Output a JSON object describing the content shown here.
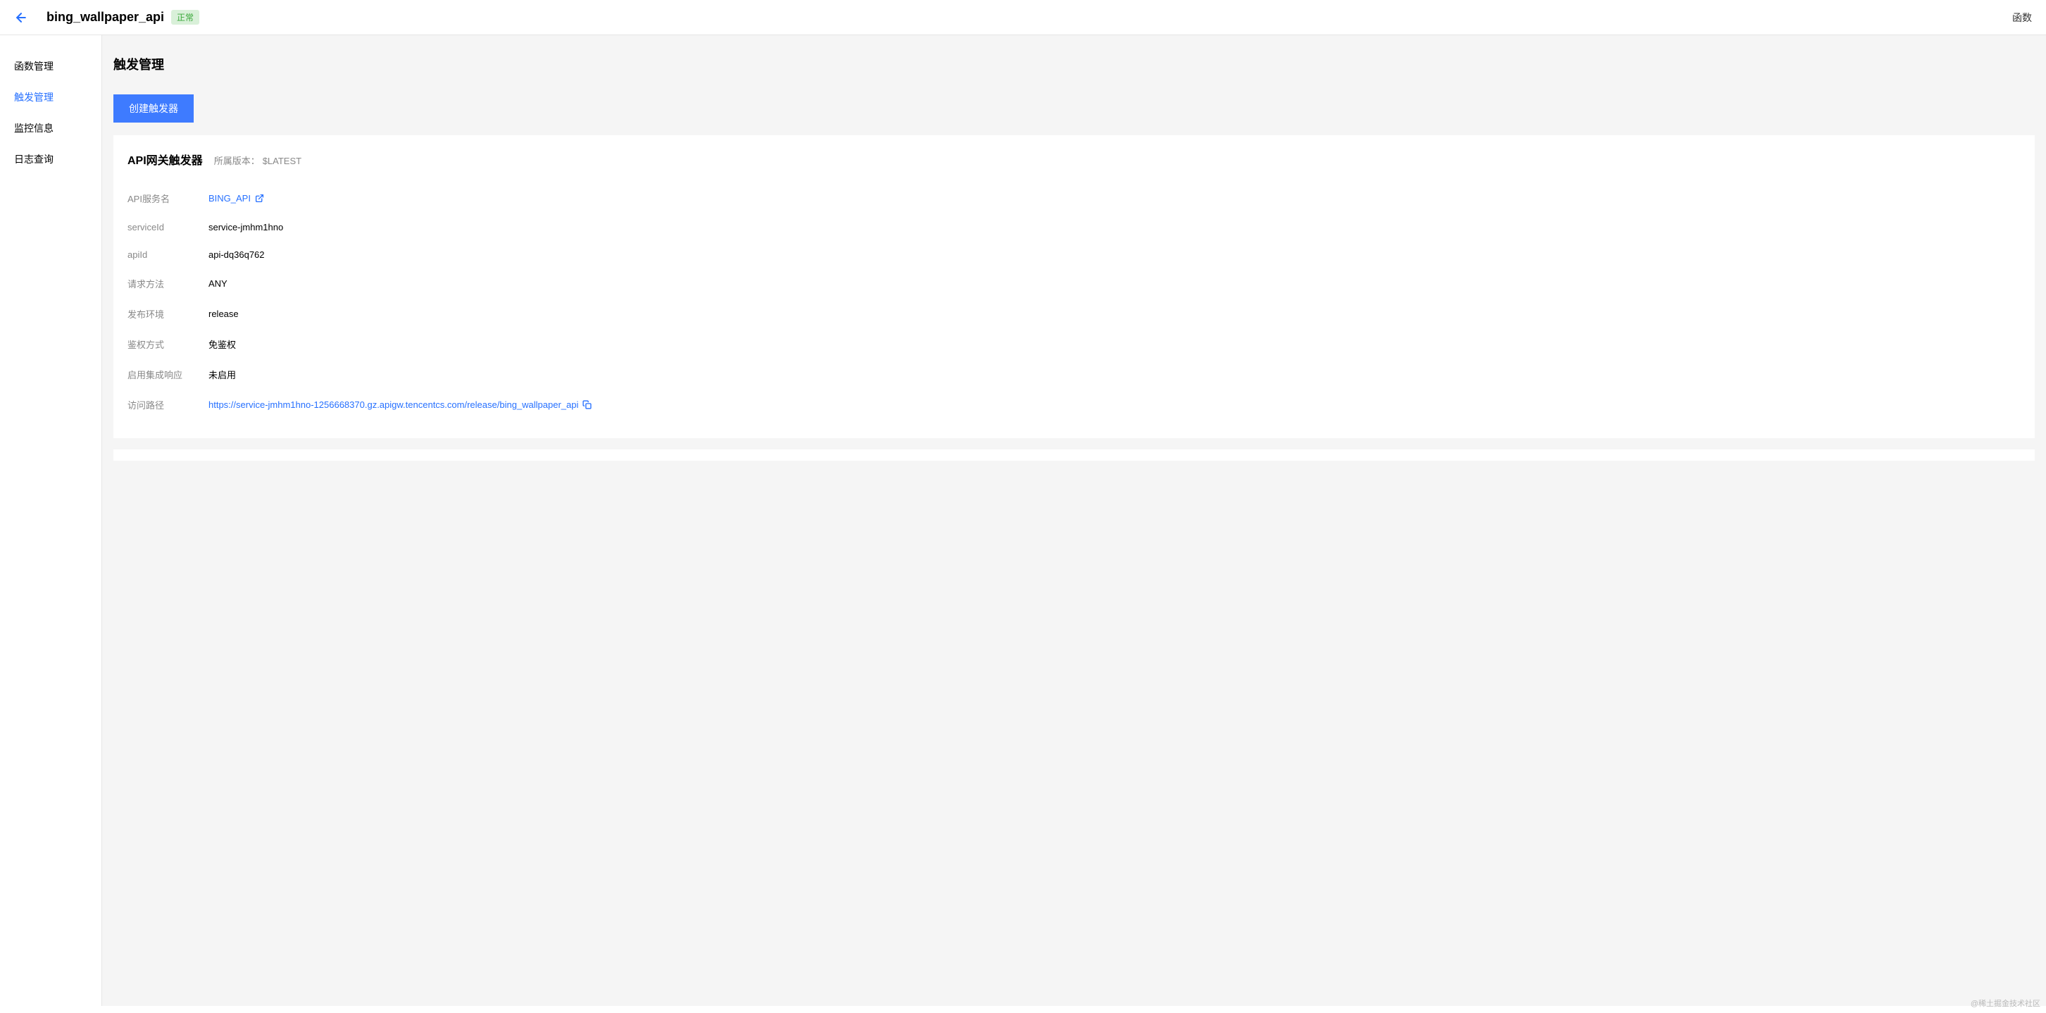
{
  "header": {
    "title": "bing_wallpaper_api",
    "status": "正常",
    "right_text": "函数"
  },
  "sidebar": {
    "items": [
      {
        "label": "函数管理"
      },
      {
        "label": "触发管理"
      },
      {
        "label": "监控信息"
      },
      {
        "label": "日志查询"
      }
    ]
  },
  "page": {
    "heading": "触发管理",
    "create_button": "创建触发器"
  },
  "card": {
    "title": "API网关触发器",
    "version_label": "所属版本：",
    "version_value": "$LATEST",
    "fields": {
      "api_service_name": {
        "label": "API服务名",
        "value": "BING_API"
      },
      "service_id": {
        "label": "serviceId",
        "value": "service-jmhm1hno"
      },
      "api_id": {
        "label": "apiId",
        "value": "api-dq36q762"
      },
      "request_method": {
        "label": "请求方法",
        "value": "ANY"
      },
      "release_env": {
        "label": "发布环境",
        "value": "release"
      },
      "auth_method": {
        "label": "鉴权方式",
        "value": "免鉴权"
      },
      "integration_response": {
        "label": "启用集成响应",
        "value": "未启用"
      },
      "access_path": {
        "label": "访问路径",
        "value": "https://service-jmhm1hno-1256668370.gz.apigw.tencentcs.com/release/bing_wallpaper_api"
      }
    }
  },
  "watermark": "@稀土掘金技术社区"
}
